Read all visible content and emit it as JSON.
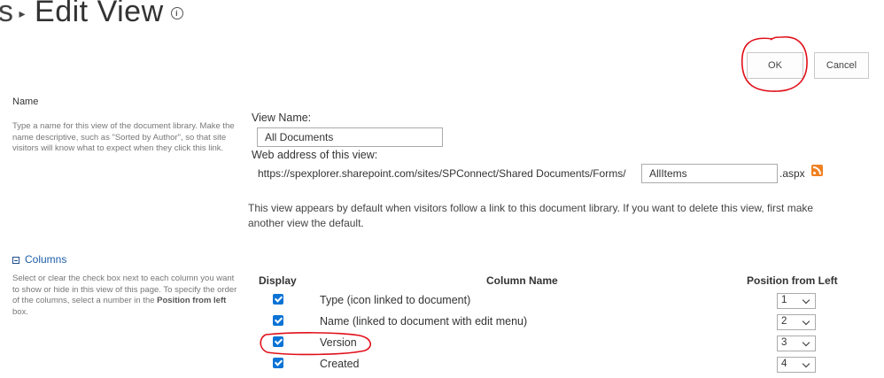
{
  "header": {
    "breadcrumb_tail": "s",
    "title": "Edit View",
    "info_icon": "info-icon"
  },
  "actions": {
    "ok_label": "OK",
    "cancel_label": "Cancel"
  },
  "name_section": {
    "label": "Name",
    "description": "Type a name for this view of the document library. Make the name descriptive, such as \"Sorted by Author\", so that site visitors will know what to expect when they click this link.",
    "view_name_label": "View Name:",
    "view_name_value": "All Documents",
    "web_address_label": "Web address of this view:",
    "url_prefix": "https://spexplorer.sharepoint.com/sites/SPConnect/Shared Documents/Forms/",
    "page_name_value": "AllItems",
    "url_suffix": ".aspx",
    "default_note": "This view appears by default when visitors follow a link to this document library. If you want to delete this view, first make another view the default."
  },
  "columns_section": {
    "label": "Columns",
    "description_prefix": "Select or clear the check box next to each column you want to show or hide in this view of this page. To specify the order of the columns, select a number in the ",
    "description_bold": "Position from left",
    "description_suffix": " box.",
    "headers": {
      "display": "Display",
      "column_name": "Column Name",
      "position": "Position from Left"
    },
    "rows": [
      {
        "name": "Type (icon linked to document)",
        "checked": true,
        "position": "1"
      },
      {
        "name": "Name (linked to document with edit menu)",
        "checked": true,
        "position": "2"
      },
      {
        "name": "Version",
        "checked": true,
        "position": "3"
      },
      {
        "name": "Created",
        "checked": true,
        "position": "4"
      }
    ]
  },
  "colors": {
    "annotation": "#e0101a",
    "checkbox": "#0b73d6",
    "link": "#1e5ea8",
    "rss": "#f08020"
  }
}
